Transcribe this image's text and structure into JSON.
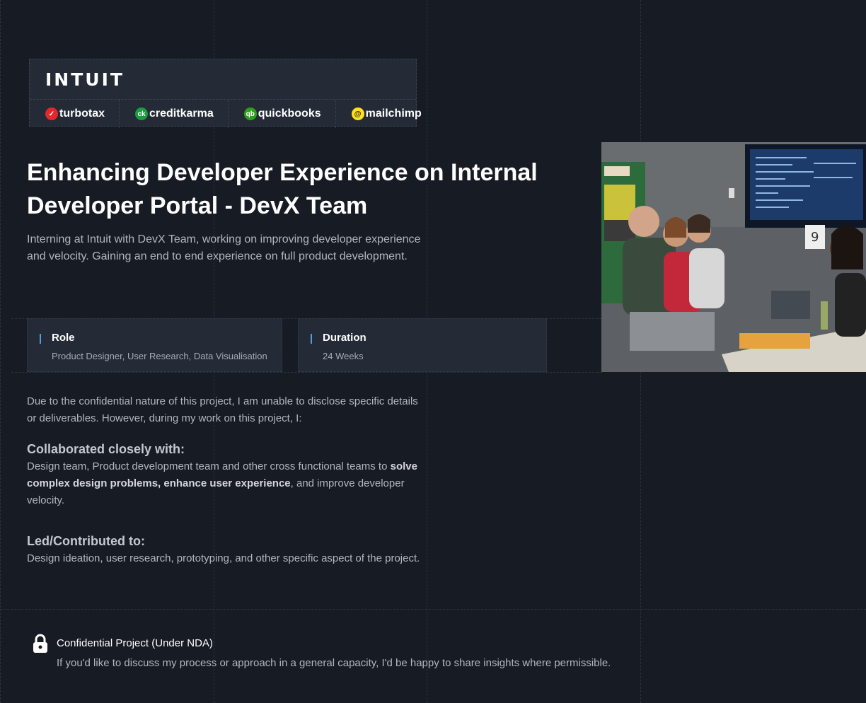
{
  "logo": {
    "company": "INTUIT",
    "brands": [
      {
        "name": "turbotax",
        "icon": "checkmark-icon",
        "color": "#e4262d"
      },
      {
        "name": "creditkarma",
        "icon": "ck-icon",
        "color": "#1a9c3e"
      },
      {
        "name": "quickbooks",
        "icon": "qb-icon",
        "color": "#2ca01c"
      },
      {
        "name": "mailchimp",
        "icon": "mailchimp-icon",
        "color": "#ffe01b"
      }
    ]
  },
  "hero": {
    "title": "Enhancing Developer Experience on Internal Developer Portal - DevX Team",
    "subtitle": "Interning at Intuit with DevX Team, working on improving developer experience and velocity. Gaining an end to end experience on full product development.",
    "photo_alt": "team-meeting-photo"
  },
  "info": {
    "role_label": "Role",
    "role_value": "Product Designer, User Research, Data Visualisation",
    "duration_label": "Duration",
    "duration_value": "24 Weeks"
  },
  "body": {
    "intro": "Due to the confidential nature of this project, I am unable to disclose specific details or deliverables. However, during my work on this project, I:",
    "collab_heading": "Collaborated closely with:",
    "collab_text_1": "Design team, Product development team and other cross functional teams to ",
    "collab_bold": "solve complex design problems, enhance user experience",
    "collab_text_2": ", and improve developer velocity.",
    "led_heading": "Led/Contributed to:",
    "led_text": "Design ideation, user research, prototyping, and other specific aspect of the project."
  },
  "footer": {
    "nda_title": "Confidential Project (Under NDA)",
    "nda_text": "If you'd like to discuss my process or approach in a general capacity, I'd be happy to share insights where permissible."
  },
  "colors": {
    "background": "#171b24",
    "card": "#242a36",
    "accent": "#4aa3e0"
  }
}
